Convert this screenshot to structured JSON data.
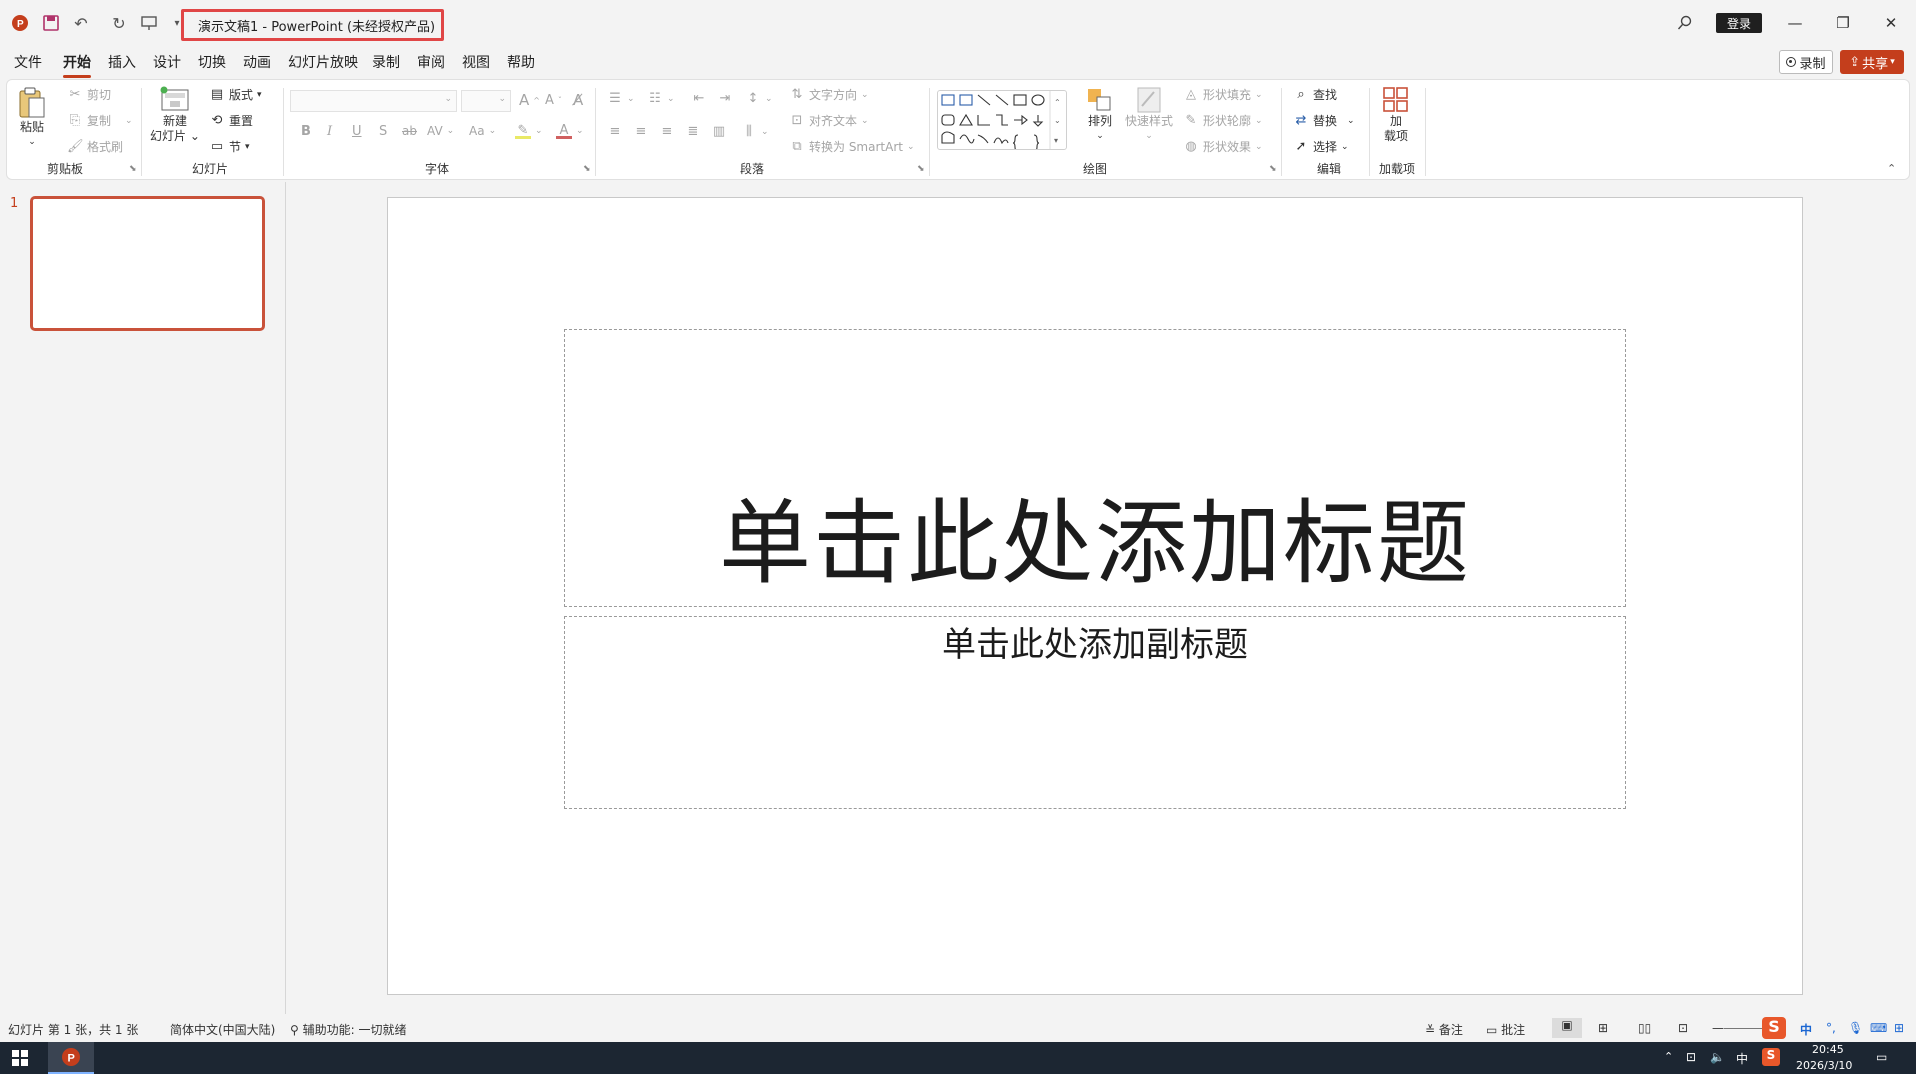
{
  "titlebar": {
    "title": "演示文稿1  -  PowerPoint (未经授权产品)",
    "login": "登录",
    "icons": [
      "powerpoint-logo-icon",
      "save-icon",
      "undo-icon",
      "redo-icon",
      "present-from-start-icon",
      "customize-qat-icon"
    ]
  },
  "tabs": [
    {
      "label": "文件"
    },
    {
      "label": "开始",
      "active": true
    },
    {
      "label": "插入"
    },
    {
      "label": "设计"
    },
    {
      "label": "切换"
    },
    {
      "label": "动画"
    },
    {
      "label": "幻灯片放映"
    },
    {
      "label": "录制"
    },
    {
      "label": "审阅"
    },
    {
      "label": "视图"
    },
    {
      "label": "帮助"
    }
  ],
  "top_right": {
    "record": "录制",
    "share": "共享"
  },
  "ribbon": {
    "clipboard": {
      "paste": "粘贴",
      "cut": "剪切",
      "copy": "复制",
      "format_painter": "格式刷",
      "group": "剪贴板"
    },
    "slides": {
      "new_slide_1": "新建",
      "new_slide_2": "幻灯片",
      "layout": "版式",
      "reset": "重置",
      "section": "节",
      "group": "幻灯片"
    },
    "font": {
      "group": "字体",
      "bold": "B",
      "italic": "I",
      "underline": "U",
      "shadow": "S",
      "strike": "ab",
      "spacing": "AV",
      "case": "Aa",
      "grow": "A",
      "shrink": "A"
    },
    "paragraph": {
      "text_direction": "文字方向",
      "align_text": "对齐文本",
      "smartart": "转换为 SmartArt",
      "group": "段落"
    },
    "drawing": {
      "arrange": "排列",
      "quick_styles": "快速样式",
      "fill": "形状填充",
      "outline": "形状轮廓",
      "effects": "形状效果",
      "group": "绘图"
    },
    "editing": {
      "find": "查找",
      "replace": "替换",
      "select": "选择",
      "group": "编辑"
    },
    "addins": {
      "label_1": "加",
      "label_2": "载项",
      "group": "加载项"
    }
  },
  "slide_pane": {
    "number": "1"
  },
  "slide": {
    "title_placeholder": "单击此处添加标题",
    "subtitle_placeholder": "单击此处添加副标题"
  },
  "statusbar": {
    "slide_info": "幻灯片 第 1 张，共 1 张",
    "language": "简体中文(中国大陆)",
    "accessibility": "辅助功能: 一切就绪",
    "notes": "备注",
    "comments": "批注"
  },
  "taskbar": {
    "time": "20:45",
    "date": "2026/3/10",
    "ime": "中"
  }
}
